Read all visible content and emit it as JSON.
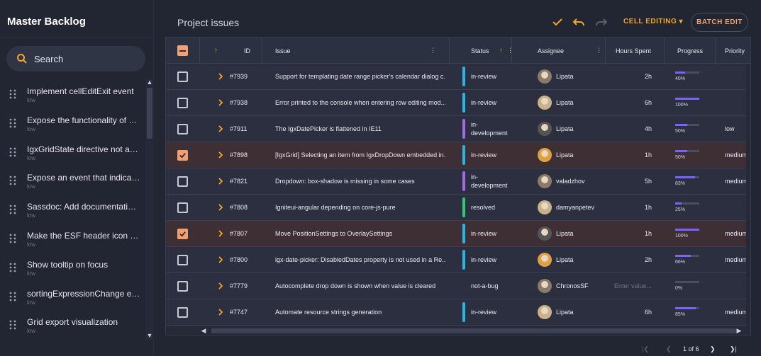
{
  "sidebar": {
    "title": "Master Backlog",
    "search_label": "Search",
    "items": [
      {
        "title": "Implement cellEditExit event",
        "priority": "low"
      },
      {
        "title": "Expose the functionality of pri...",
        "priority": "low"
      },
      {
        "title": "IgxGridState directive not abl...",
        "priority": "low"
      },
      {
        "title": "Expose an event that indicate...",
        "priority": "low"
      },
      {
        "title": "Sassdoc: Add documentation ...",
        "priority": "low"
      },
      {
        "title": "Make the ESF header icon te...",
        "priority": "low"
      },
      {
        "title": "Show tooltip on focus",
        "priority": "low"
      },
      {
        "title": "sortingExpressionChange eve...",
        "priority": "low"
      },
      {
        "title": "Grid export visualization",
        "priority": "low"
      }
    ]
  },
  "toolbar": {
    "title": "Project issues",
    "cell_editing": "CELL EDITING",
    "batch_edit": "BATCH EDIT"
  },
  "columns": {
    "id": "ID",
    "issue": "Issue",
    "status": "Status",
    "assignee": "Assignee",
    "hours": "Hours Spent",
    "progress": "Progress",
    "priority": "Priority"
  },
  "rows": [
    {
      "id": "#7939",
      "issue": "Support for templating date range picker's calendar dialog c...",
      "status": "in-review",
      "status_color": "#29b6e0",
      "assignee": "Lipata",
      "hours": "2h",
      "progress": 40,
      "progress_label": "40%",
      "priority": "",
      "selected": false
    },
    {
      "id": "#7938",
      "issue": "Error printed to the console when entering row editing mod...",
      "status": "in-review",
      "status_color": "#29b6e0",
      "assignee": "Lipata",
      "hours": "6h",
      "progress": 100,
      "progress_label": "100%",
      "priority": "",
      "selected": false
    },
    {
      "id": "#7911",
      "issue": "The IgxDatePicker is flattened in IE11",
      "status": "in-\ndevelopment",
      "status_color": "#a46be0",
      "assignee": "Lipata",
      "hours": "4h",
      "progress": 50,
      "progress_label": "50%",
      "priority": "low",
      "selected": false
    },
    {
      "id": "#7898",
      "issue": "[IgxGrid] Selecting an item from IgxDropDown embedded in...",
      "status": "in-review",
      "status_color": "#29b6e0",
      "assignee": "Lipata",
      "hours": "1h",
      "progress": 50,
      "progress_label": "50%",
      "priority": "medium",
      "selected": true
    },
    {
      "id": "#7821",
      "issue": "Dropdown: box-shadow is missing in some cases",
      "status": "in-\ndevelopment",
      "status_color": "#a46be0",
      "assignee": "valadzhov",
      "hours": "5h",
      "progress": 83,
      "progress_label": "83%",
      "priority": "medium",
      "selected": false
    },
    {
      "id": "#7808",
      "issue": "Igniteui-angular depending on core-js-pure",
      "status": "resolved",
      "status_color": "#2ecc71",
      "assignee": "damyanpetev",
      "hours": "1h",
      "progress": 25,
      "progress_label": "25%",
      "priority": "",
      "selected": false
    },
    {
      "id": "#7807",
      "issue": "Move PositionSettings to OverlaySettings",
      "status": "in-review",
      "status_color": "#29b6e0",
      "assignee": "Lipata",
      "hours": "1h",
      "progress": 100,
      "progress_label": "100%",
      "priority": "medium",
      "selected": true
    },
    {
      "id": "#7800",
      "issue": "igx-date-picker: DisabledDates property is not used in a Re...",
      "status": "in-review",
      "status_color": "#29b6e0",
      "assignee": "Lipata",
      "hours": "2h",
      "progress": 66,
      "progress_label": "66%",
      "priority": "medium",
      "selected": false
    },
    {
      "id": "#7779",
      "issue": "Autocomplete drop down is shown when value is cleared",
      "status": "not-a-bug",
      "status_color": "",
      "assignee": "ChronosSF",
      "hours": "Enter value...",
      "progress": 0,
      "progress_label": "0%",
      "priority": "",
      "selected": false
    },
    {
      "id": "#7747",
      "issue": "Automate resource strings generation",
      "status": "in-review",
      "status_color": "#29b6e0",
      "assignee": "Lipata",
      "hours": "6h",
      "progress": 85,
      "progress_label": "85%",
      "priority": "medium",
      "selected": false
    }
  ],
  "pager": {
    "label": "1 of 6"
  },
  "colors": {
    "accent": "#f5a623",
    "selected_row": "#3e2f35",
    "progress": "#7b61ff"
  }
}
